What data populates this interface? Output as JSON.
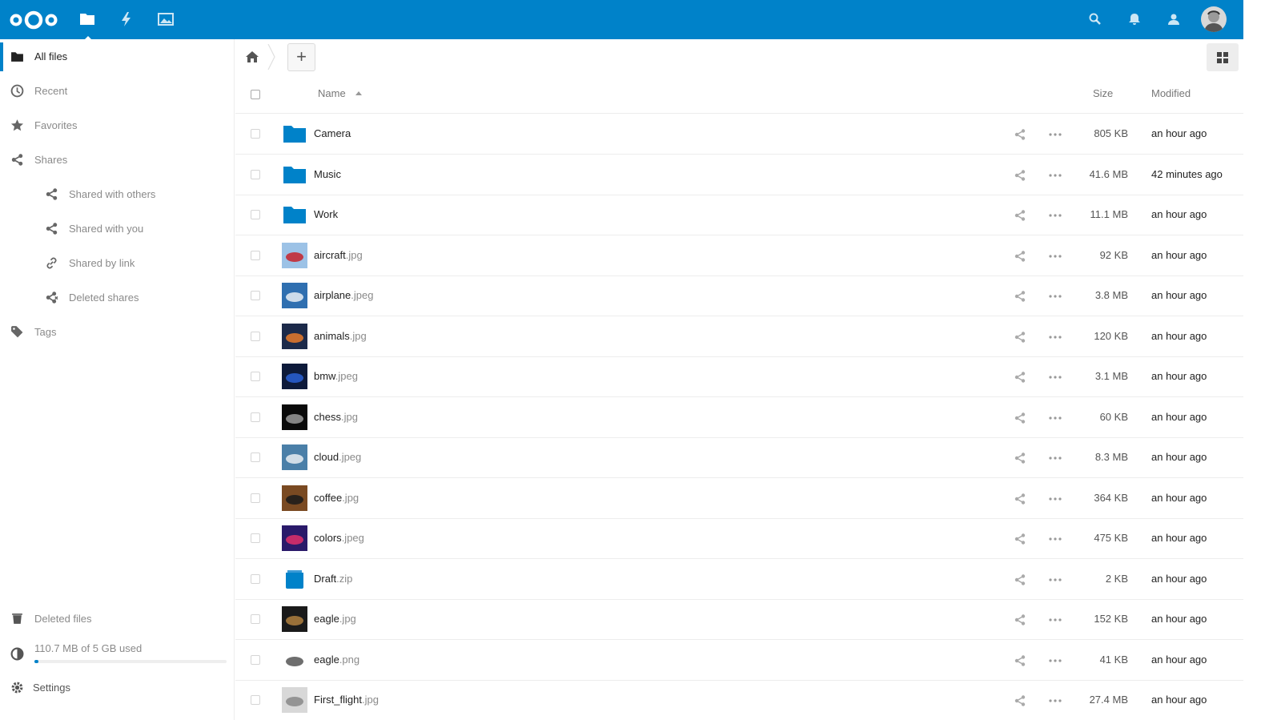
{
  "header": {
    "apps": [
      {
        "name": "files-app-icon",
        "active": true
      },
      {
        "name": "activity-app-icon",
        "active": false
      },
      {
        "name": "gallery-app-icon",
        "active": false
      }
    ],
    "right_icons": [
      "search-icon",
      "notifications-icon",
      "contacts-icon"
    ],
    "accent_color": "#0082c9"
  },
  "sidebar": {
    "items": [
      {
        "label": "All files",
        "icon": "folder-icon",
        "active": true
      },
      {
        "label": "Recent",
        "icon": "clock-icon"
      },
      {
        "label": "Favorites",
        "icon": "star-icon"
      },
      {
        "label": "Shares",
        "icon": "share-icon"
      },
      {
        "label": "Shared with others",
        "icon": "share-icon",
        "sub": true
      },
      {
        "label": "Shared with you",
        "icon": "share-icon",
        "sub": true
      },
      {
        "label": "Shared by link",
        "icon": "link-icon",
        "sub": true
      },
      {
        "label": "Deleted shares",
        "icon": "deleted-share-icon",
        "sub": true
      },
      {
        "label": "Tags",
        "icon": "tag-icon"
      }
    ],
    "deleted_files": "Deleted files",
    "quota_text": "110.7 MB of 5 GB used",
    "quota_fraction": 0.022,
    "settings": "Settings"
  },
  "controls": {
    "add_label": "+"
  },
  "table": {
    "headers": {
      "name": "Name",
      "size": "Size",
      "modified": "Modified"
    },
    "rows": [
      {
        "base": "Camera",
        "ext": "",
        "type": "folder",
        "size": "805 KB",
        "modified": "an hour ago"
      },
      {
        "base": "Music",
        "ext": "",
        "type": "folder",
        "size": "41.6 MB",
        "modified": "42 minutes ago"
      },
      {
        "base": "Work",
        "ext": "",
        "type": "folder",
        "size": "11.1 MB",
        "modified": "an hour ago"
      },
      {
        "base": "aircraft",
        "ext": ".jpg",
        "type": "image",
        "thumb": [
          "#9cc2e6",
          "#c7222a"
        ],
        "size": "92 KB",
        "modified": "an hour ago"
      },
      {
        "base": "airplane",
        "ext": ".jpeg",
        "type": "image",
        "thumb": [
          "#2f6fb0",
          "#e8eef5"
        ],
        "size": "3.8 MB",
        "modified": "an hour ago"
      },
      {
        "base": "animals",
        "ext": ".jpg",
        "type": "image",
        "thumb": [
          "#1c2a4a",
          "#e87a2a"
        ],
        "size": "120 KB",
        "modified": "an hour ago"
      },
      {
        "base": "bmw",
        "ext": ".jpeg",
        "type": "image",
        "thumb": [
          "#0d1a3a",
          "#2a62d6"
        ],
        "size": "3.1 MB",
        "modified": "an hour ago"
      },
      {
        "base": "chess",
        "ext": ".jpg",
        "type": "image",
        "thumb": [
          "#0a0a0a",
          "#9a9a9a"
        ],
        "size": "60 KB",
        "modified": "an hour ago"
      },
      {
        "base": "cloud",
        "ext": ".jpeg",
        "type": "image",
        "thumb": [
          "#4a7fa8",
          "#e8edf2"
        ],
        "size": "8.3 MB",
        "modified": "an hour ago"
      },
      {
        "base": "coffee",
        "ext": ".jpg",
        "type": "image",
        "thumb": [
          "#7a4a22",
          "#1a1a1a"
        ],
        "size": "364 KB",
        "modified": "an hour ago"
      },
      {
        "base": "colors",
        "ext": ".jpeg",
        "type": "image",
        "thumb": [
          "#2a1a6a",
          "#e0306a"
        ],
        "size": "475 KB",
        "modified": "an hour ago"
      },
      {
        "base": "Draft",
        "ext": ".zip",
        "type": "archive",
        "size": "2 KB",
        "modified": "an hour ago"
      },
      {
        "base": "eagle",
        "ext": ".jpg",
        "type": "image",
        "thumb": [
          "#1a1a1a",
          "#b08040"
        ],
        "size": "152 KB",
        "modified": "an hour ago"
      },
      {
        "base": "eagle",
        "ext": ".png",
        "type": "image",
        "thumb": [
          "#ffffff",
          "#555555"
        ],
        "size": "41 KB",
        "modified": "an hour ago"
      },
      {
        "base": "First_flight",
        "ext": ".jpg",
        "type": "image",
        "thumb": [
          "#d8d8d8",
          "#888888"
        ],
        "size": "27.4 MB",
        "modified": "an hour ago"
      }
    ]
  }
}
